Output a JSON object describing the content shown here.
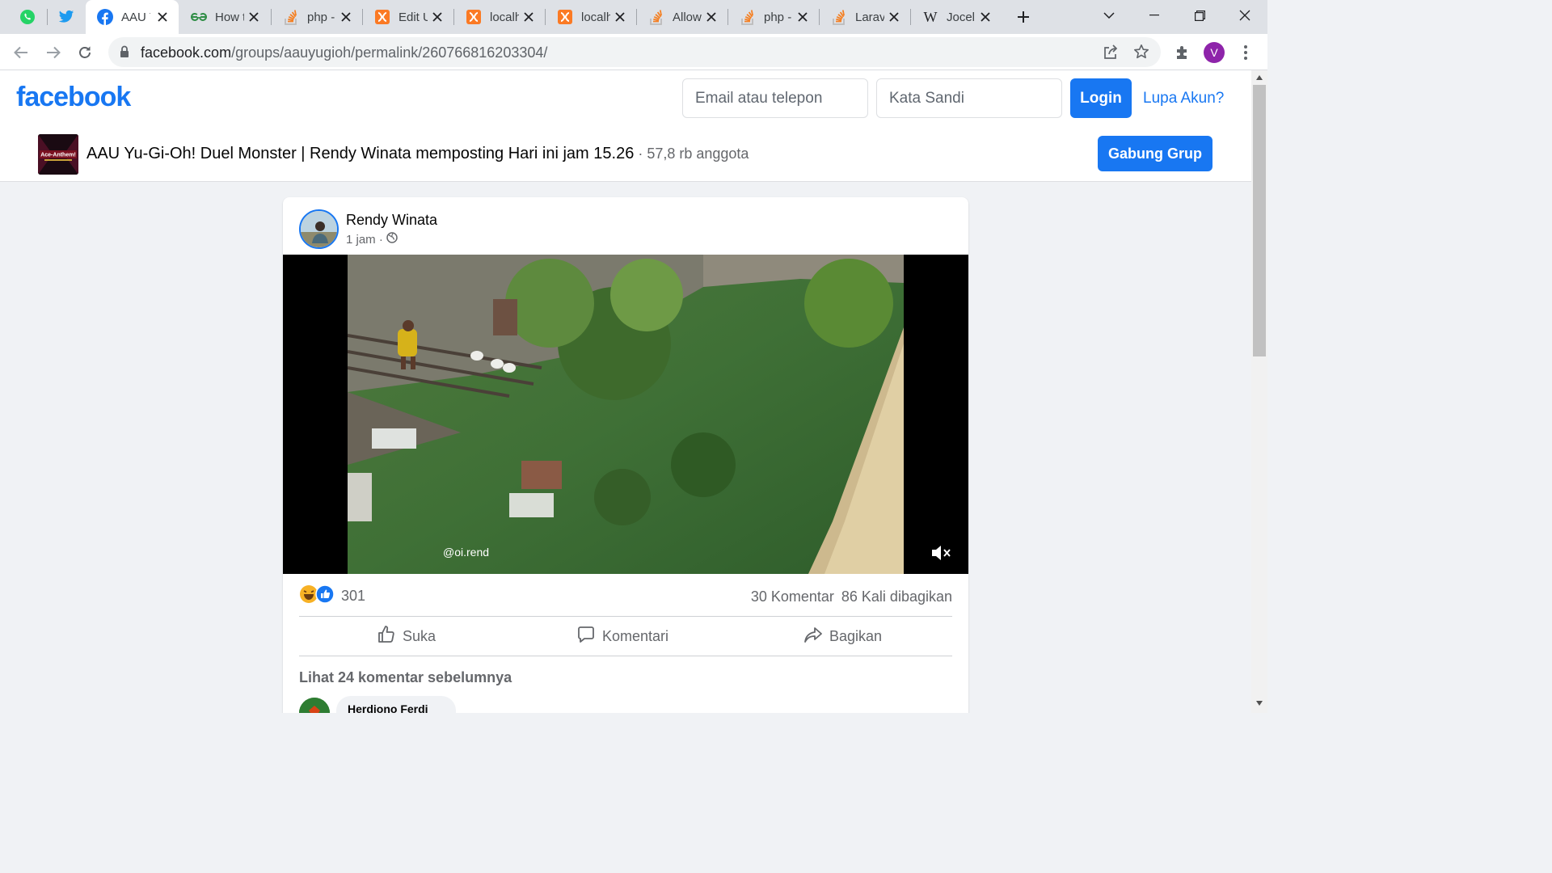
{
  "browser": {
    "tabs": [
      {
        "title": "AAU Yu-Gi-Oh!",
        "icon": "facebook-icon",
        "active": true
      },
      {
        "title": "How to",
        "icon": "geeksforgeeks-icon"
      },
      {
        "title": "php - ",
        "icon": "stackoverflow-icon"
      },
      {
        "title": "Edit U",
        "icon": "xampp-icon"
      },
      {
        "title": "localh",
        "icon": "xampp-icon"
      },
      {
        "title": "localh",
        "icon": "xampp-icon"
      },
      {
        "title": "Allow",
        "icon": "stackoverflow-icon"
      },
      {
        "title": "php - ",
        "icon": "stackoverflow-icon"
      },
      {
        "title": "Larav",
        "icon": "stackoverflow-icon"
      },
      {
        "title": "Jocel",
        "icon": "wikipedia-icon"
      }
    ],
    "pinned": [
      "whatsapp-icon",
      "twitter-icon"
    ],
    "url_host": "facebook.com",
    "url_path": "/groups/aauyugioh/permalink/260766816203304/",
    "profile_initial": "V",
    "profile_color": "#8e24aa"
  },
  "header": {
    "logo": "facebook",
    "email_placeholder": "Email atau telepon",
    "password_placeholder": "Kata Sandi",
    "login_label": "Login",
    "forgot_label": "Lupa Akun?",
    "brand_color": "#1877f2"
  },
  "group": {
    "title": "AAU Yu-Gi-Oh! Duel Monster | Rendy Winata memposting Hari ini jam 15.26",
    "members": " · 57,8 rb anggota",
    "join_label": "Gabung Grup",
    "thumb_text": "Ace-Anthem!"
  },
  "post": {
    "author": "Rendy Winata",
    "time": "1 jam ·",
    "video_watermark": "@oi.rend",
    "reaction_count": "301",
    "comments": "30 Komentar",
    "shares": "86 Kali dibagikan",
    "actions": {
      "like": "Suka",
      "comment": "Komentari",
      "share": "Bagikan"
    },
    "previous_comments": "Lihat 24 komentar sebelumnya",
    "first_commenter": "Herdiono Ferdi"
  }
}
